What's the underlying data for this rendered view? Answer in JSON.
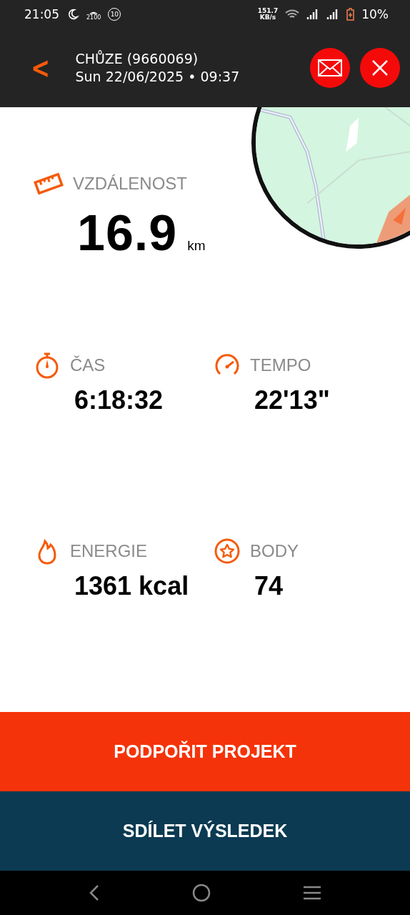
{
  "status_bar": {
    "time": "21:05",
    "hotspot_label": "2100",
    "notification_count": "10",
    "speed_value": "151.7",
    "speed_unit": "KB/s",
    "battery": "10%"
  },
  "header": {
    "back": "<",
    "title": "CHŮZE (9660069)",
    "subtitle": "Sun 22/06/2025 • 09:37"
  },
  "distance": {
    "label": "VZDÁLENOST",
    "value": "16.9",
    "unit": "km"
  },
  "stats": [
    {
      "label": "ČAS",
      "value": "6:18:32"
    },
    {
      "label": "TEMPO",
      "value": "22'13\""
    },
    {
      "label": "ENERGIE",
      "value": "1361 kcal"
    },
    {
      "label": "BODY",
      "value": "74"
    }
  ],
  "buttons": [
    "PODPOŘIT PROJEKT",
    "SDÍLET VÝSLEDEK"
  ]
}
